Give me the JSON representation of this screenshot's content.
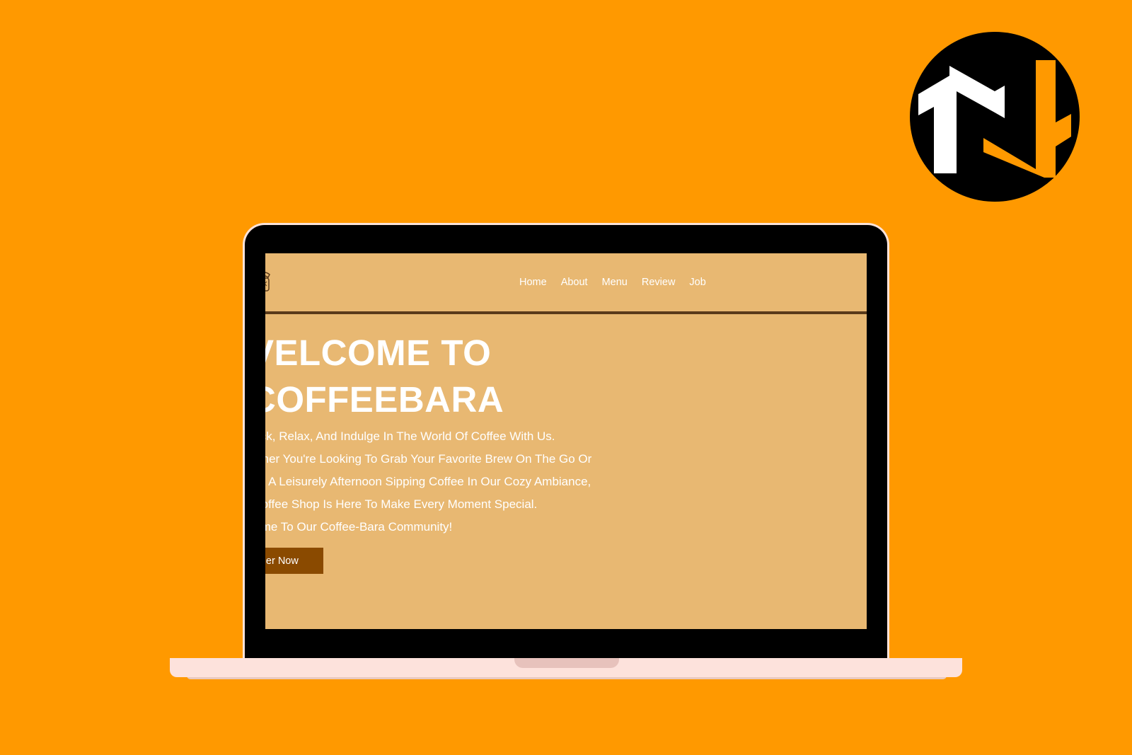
{
  "colors": {
    "background": "#FF9900",
    "screen_bg": "#E8B872",
    "nav_divider": "#5A3A1A",
    "button_bg": "#8A4A00",
    "text": "#FFFFFF"
  },
  "brand_logo": {
    "icon": "tn-monogram-logo"
  },
  "site": {
    "logo_icon": "coffee-cup-icon",
    "nav": {
      "items": [
        {
          "label": "Home"
        },
        {
          "label": "About"
        },
        {
          "label": "Menu"
        },
        {
          "label": "Review"
        },
        {
          "label": "Job"
        }
      ]
    },
    "hero": {
      "title_line1": "VELCOME TO",
      "title_line2": "COFFEEBARA",
      "lines": [
        "Back, Relax, And Indulge In The World Of Coffee With Us.",
        "hether You're Looking To Grab Your Favorite Brew On The Go Or",
        "end A Leisurely Afternoon Sipping Coffee In Our Cozy Ambiance,",
        "r Coffee Shop Is Here To Make Every Moment Special.",
        "lcome To Our Coffee-Bara Community!"
      ],
      "button_label": "rder Now"
    }
  }
}
